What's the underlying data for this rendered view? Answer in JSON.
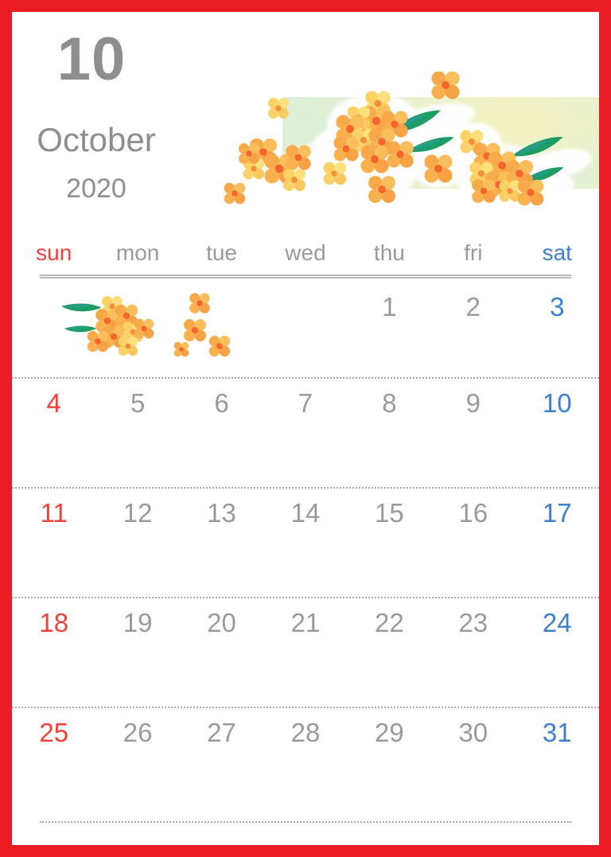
{
  "frame": {
    "border_color": "#ec1c24",
    "sheet_color": "#ffffff"
  },
  "header": {
    "month_number": "10",
    "month_name": "October",
    "year": "2020",
    "text_color": "#8e8e8e",
    "banner": {
      "name": "osmanthus-flower-banner",
      "background_from": "#dff0dc",
      "background_to": "#f3f1c6",
      "flower_color": "#f5a03c",
      "flower_center_color": "#f2622e",
      "leaf_color": "#17a06a"
    }
  },
  "weekdays": [
    {
      "label": "sun",
      "kind": "sunday",
      "color": "#f4423a"
    },
    {
      "label": "mon",
      "kind": "weekday",
      "color": "#9a9a9a"
    },
    {
      "label": "tue",
      "kind": "weekday",
      "color": "#9a9a9a"
    },
    {
      "label": "wed",
      "kind": "weekday",
      "color": "#9a9a9a"
    },
    {
      "label": "thu",
      "kind": "weekday",
      "color": "#9a9a9a"
    },
    {
      "label": "fri",
      "kind": "weekday",
      "color": "#9a9a9a"
    },
    {
      "label": "sat",
      "kind": "saturday",
      "color": "#3d7fd1"
    }
  ],
  "weeks": [
    {
      "days": [
        "",
        "",
        "",
        "",
        "1",
        "2",
        "3"
      ]
    },
    {
      "days": [
        "4",
        "5",
        "6",
        "7",
        "8",
        "9",
        "10"
      ]
    },
    {
      "days": [
        "11",
        "12",
        "13",
        "14",
        "15",
        "16",
        "17"
      ]
    },
    {
      "days": [
        "18",
        "19",
        "20",
        "21",
        "22",
        "23",
        "24"
      ]
    },
    {
      "days": [
        "25",
        "26",
        "27",
        "28",
        "29",
        "30",
        "31"
      ]
    }
  ],
  "decorations": {
    "grid_sprig_name": "osmanthus-sprig-illustration"
  }
}
